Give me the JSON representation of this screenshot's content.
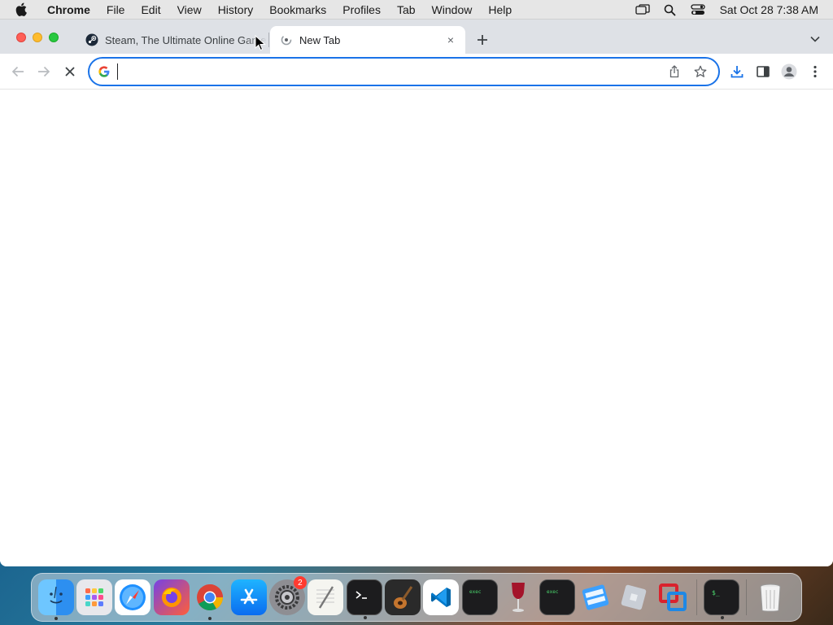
{
  "menubar": {
    "apple_icon": "apple-icon",
    "items": [
      "Chrome",
      "File",
      "Edit",
      "View",
      "History",
      "Bookmarks",
      "Profiles",
      "Tab",
      "Window",
      "Help"
    ],
    "clock": "Sat Oct 28  7:38 AM"
  },
  "browser": {
    "tabs": [
      {
        "title": "Steam, The Ultimate Online Game Platform",
        "favicon": "steam-icon",
        "active": false
      },
      {
        "title": "New Tab",
        "favicon": "chrome-loading-icon",
        "active": true,
        "close": "×"
      }
    ],
    "omnibox": {
      "value": "",
      "placeholder": ""
    }
  },
  "dock": {
    "apps": [
      "Finder",
      "Launchpad",
      "Safari",
      "Firefox",
      "Google Chrome",
      "App Store",
      "System Settings",
      "TextEdit",
      "Terminal",
      "GarageBand",
      "Visual Studio Code",
      "exec",
      "Wine",
      "exec",
      "Roblox",
      "Roblox Studio",
      "Parallels",
      "Terminal",
      "Trash"
    ],
    "settings_badge": "2"
  },
  "colors": {
    "accent": "#1a73e8",
    "tabstrip": "#dee1e6",
    "menubar": "#e6e6e6"
  }
}
